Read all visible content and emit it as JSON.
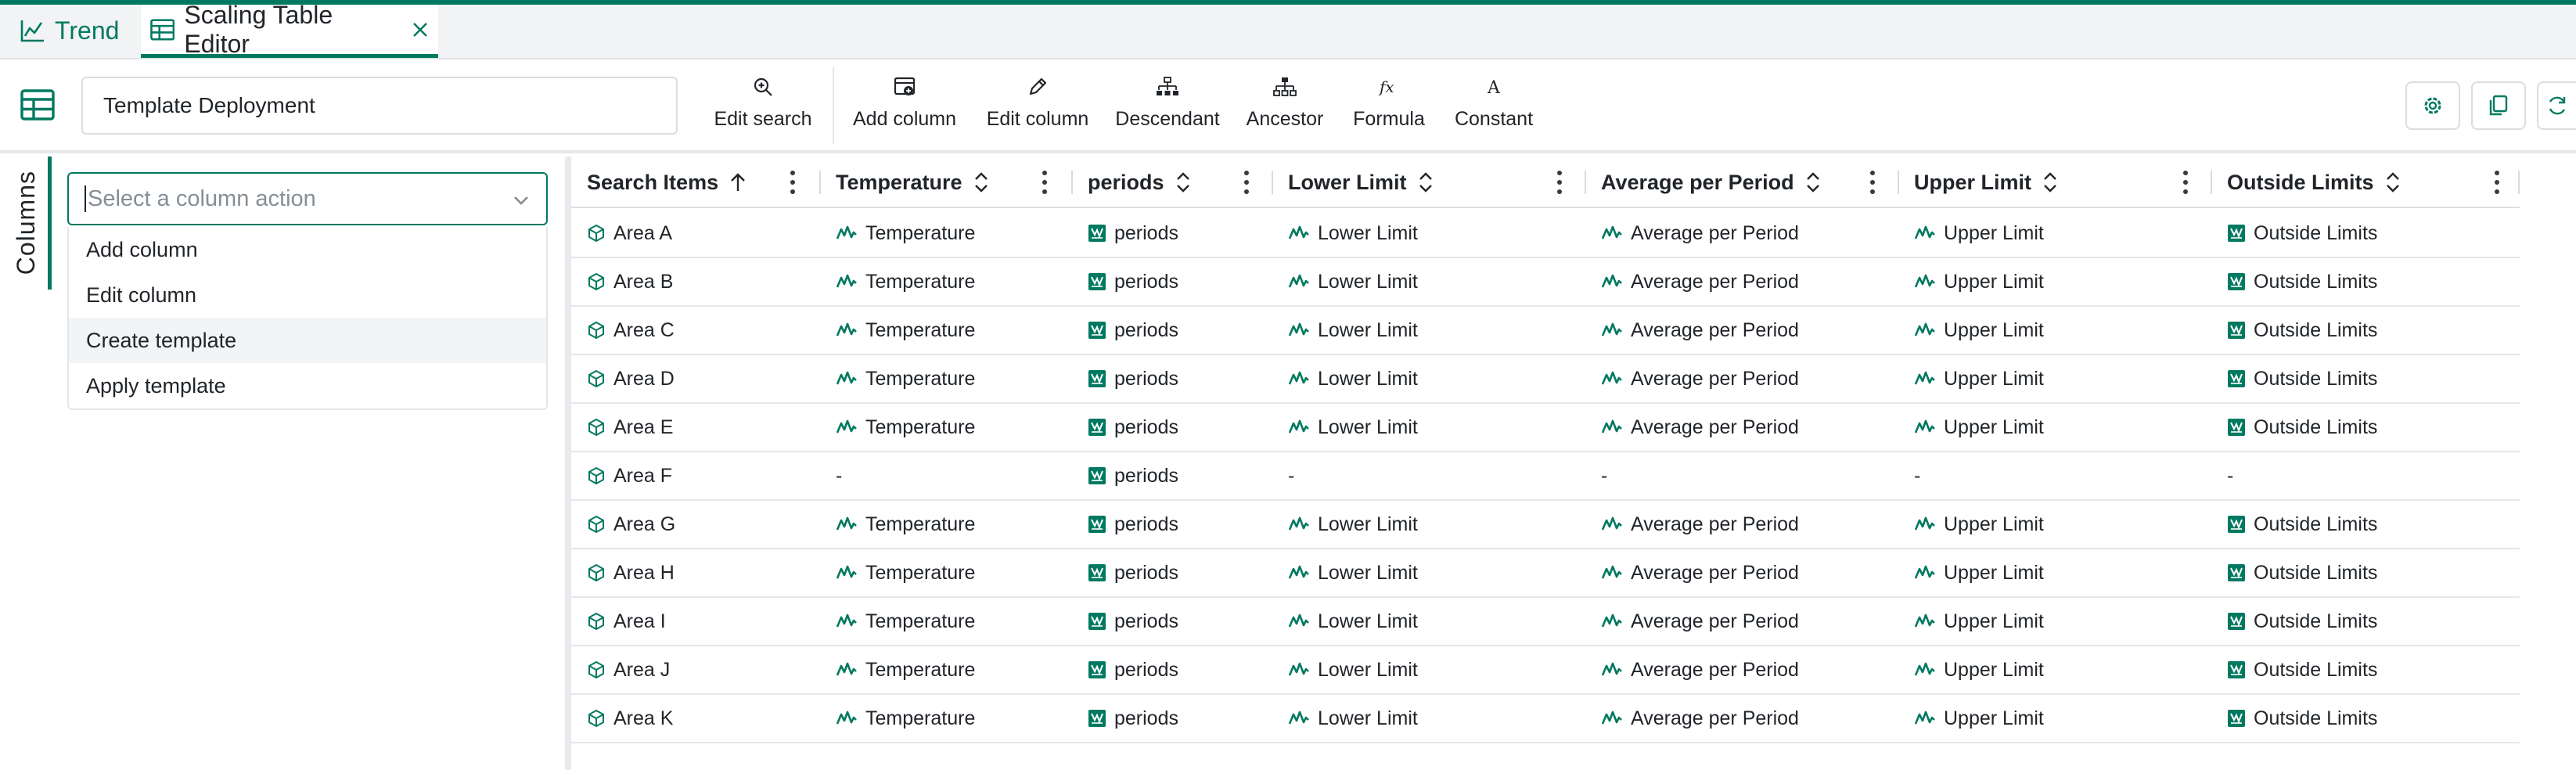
{
  "tabs": [
    {
      "label": "Trend"
    },
    {
      "label": "Scaling Table Editor"
    }
  ],
  "toolbar": {
    "name_value": "Template Deployment",
    "buttons": {
      "edit_search": "Edit search",
      "add_column": "Add column",
      "edit_column": "Edit column",
      "descendant": "Descendant",
      "ancestor": "Ancestor",
      "formula": "Formula",
      "constant": "Constant"
    }
  },
  "side_panel": {
    "tab_label": "Columns",
    "select_placeholder": "Select a column action",
    "options": [
      "Add column",
      "Edit column",
      "Create template",
      "Apply template"
    ],
    "highlighted_index": 2
  },
  "table": {
    "columns": [
      {
        "label": "Search Items",
        "sort": "asc"
      },
      {
        "label": "Temperature",
        "sort": "none"
      },
      {
        "label": "periods",
        "sort": "none"
      },
      {
        "label": "Lower Limit",
        "sort": "none"
      },
      {
        "label": "Average per Period",
        "sort": "none"
      },
      {
        "label": "Upper Limit",
        "sort": "none"
      },
      {
        "label": "Outside Limits",
        "sort": "none"
      }
    ],
    "rows": [
      {
        "name": "Area A",
        "cells": [
          "Temperature",
          "periods",
          "Lower Limit",
          "Average per Period",
          "Upper Limit",
          "Outside Limits"
        ]
      },
      {
        "name": "Area B",
        "cells": [
          "Temperature",
          "periods",
          "Lower Limit",
          "Average per Period",
          "Upper Limit",
          "Outside Limits"
        ]
      },
      {
        "name": "Area C",
        "cells": [
          "Temperature",
          "periods",
          "Lower Limit",
          "Average per Period",
          "Upper Limit",
          "Outside Limits"
        ]
      },
      {
        "name": "Area D",
        "cells": [
          "Temperature",
          "periods",
          "Lower Limit",
          "Average per Period",
          "Upper Limit",
          "Outside Limits"
        ]
      },
      {
        "name": "Area E",
        "cells": [
          "Temperature",
          "periods",
          "Lower Limit",
          "Average per Period",
          "Upper Limit",
          "Outside Limits"
        ]
      },
      {
        "name": "Area F",
        "cells": [
          "-",
          "periods",
          "-",
          "-",
          "-",
          "-"
        ]
      },
      {
        "name": "Area G",
        "cells": [
          "Temperature",
          "periods",
          "Lower Limit",
          "Average per Period",
          "Upper Limit",
          "Outside Limits"
        ]
      },
      {
        "name": "Area H",
        "cells": [
          "Temperature",
          "periods",
          "Lower Limit",
          "Average per Period",
          "Upper Limit",
          "Outside Limits"
        ]
      },
      {
        "name": "Area I",
        "cells": [
          "Temperature",
          "periods",
          "Lower Limit",
          "Average per Period",
          "Upper Limit",
          "Outside Limits"
        ]
      },
      {
        "name": "Area J",
        "cells": [
          "Temperature",
          "periods",
          "Lower Limit",
          "Average per Period",
          "Upper Limit",
          "Outside Limits"
        ]
      },
      {
        "name": "Area K",
        "cells": [
          "Temperature",
          "periods",
          "Lower Limit",
          "Average per Period",
          "Upper Limit",
          "Outside Limits"
        ]
      }
    ],
    "cell_icons": [
      "signal-icon",
      "condition-icon",
      "signal-icon",
      "signal-icon",
      "signal-icon",
      "condition-icon"
    ],
    "row_icon": "asset-cube-icon"
  },
  "colors": {
    "accent": "#007960",
    "tab_bar_bg": "#f1f3f4",
    "icon_green": "#007960"
  }
}
